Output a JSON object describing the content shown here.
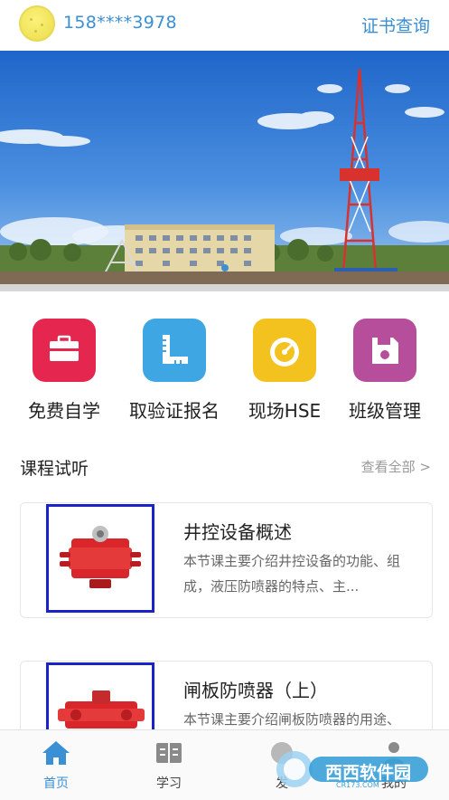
{
  "header": {
    "phone": "158****3978",
    "cert_query_label": "证书查询"
  },
  "quick_menu": [
    {
      "label": "免费自学",
      "color": "#e5264e",
      "icon": "briefcase-icon"
    },
    {
      "label": "取验证报名",
      "color": "#3ea7e3",
      "icon": "ruler-icon"
    },
    {
      "label": "现场HSE",
      "color": "#f4c21e",
      "icon": "gauge-icon"
    },
    {
      "label": "班级管理",
      "color": "#b64e9c",
      "icon": "floppy-disk-icon"
    }
  ],
  "courses_section": {
    "title": "课程试听",
    "see_all_label": "查看全部 >"
  },
  "courses": [
    {
      "title": "井控设备概述",
      "description": "本节课主要介绍井控设备的功能、组成，液压防喷器的特点、主..."
    },
    {
      "title": "闸板防喷器（上）",
      "description": "本节课主要介绍闸板防喷器的用途、"
    }
  ],
  "bottom_nav": {
    "items": [
      {
        "label": "首页",
        "active": true,
        "icon": "home-icon"
      },
      {
        "label": "学习",
        "active": false,
        "icon": "book-icon"
      },
      {
        "label": "发",
        "active": false,
        "icon": "discover-icon"
      },
      {
        "label": "我的",
        "active": false,
        "icon": "profile-icon"
      }
    ]
  },
  "watermark": {
    "text": "西西软件园",
    "subtext": "CR173.COM"
  },
  "colors": {
    "accent": "#3b8fd4",
    "thumb_border": "#1a22c8"
  }
}
